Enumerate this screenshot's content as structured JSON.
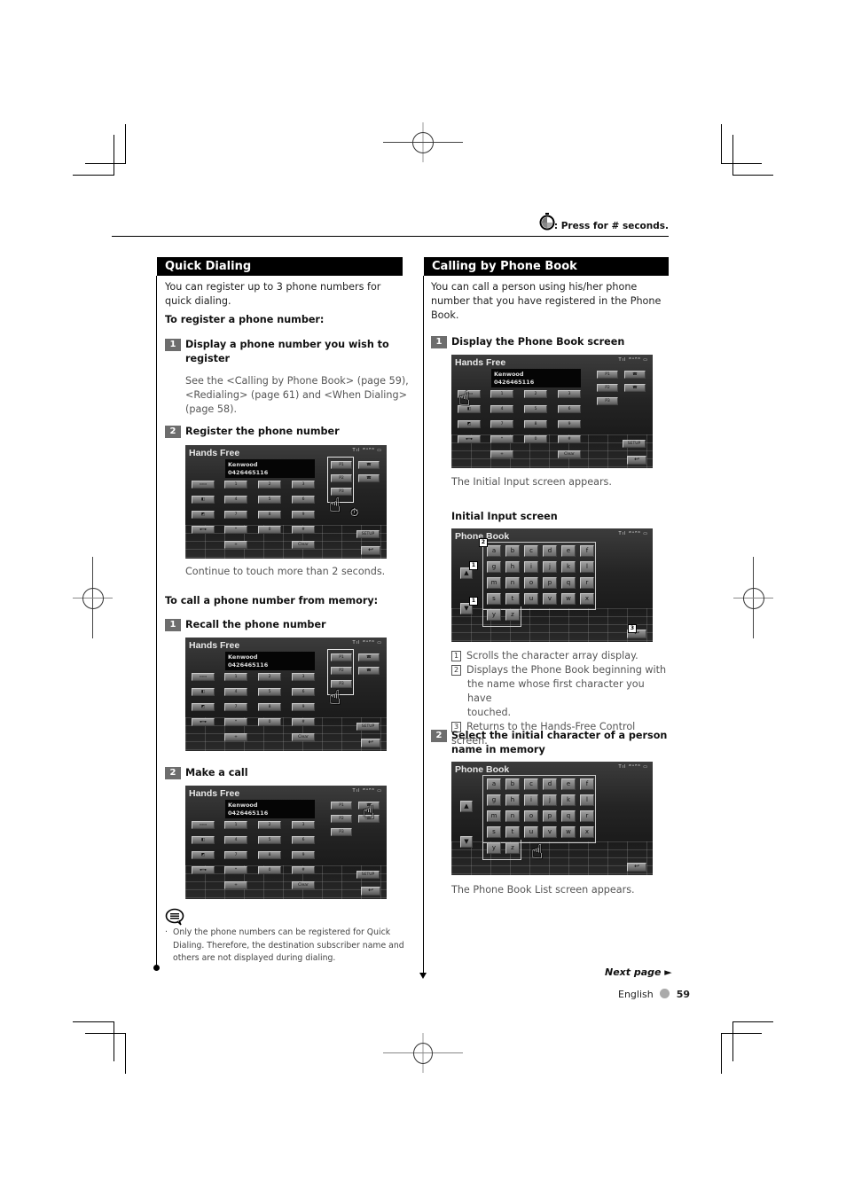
{
  "header": {
    "timer_icon": "stopwatch-icon",
    "press_note": ": Press for # seconds."
  },
  "left": {
    "section_title": "Quick Dialing",
    "intro": "You can register up to 3 phone numbers for quick dialing.",
    "register_heading": "To register a phone number:",
    "register_steps": [
      {
        "num": "1",
        "title_line1": "Display a phone number you wish to",
        "title_line2": "register",
        "body_line1": "See the <Calling by Phone Book> (page 59),",
        "body_line2": "<Redialing> (page 61) and <When Dialing>",
        "body_line3": "(page 58)."
      },
      {
        "num": "2",
        "title": "Register the phone number",
        "caption": "Continue to touch more than 2 seconds."
      }
    ],
    "call_heading": "To call a phone number from memory:",
    "call_steps": [
      {
        "num": "1",
        "title": "Recall the phone number"
      },
      {
        "num": "2",
        "title": "Make a call"
      }
    ],
    "note_icon": "speech-note-icon",
    "note_line1": "Only the phone numbers can be registered for Quick",
    "note_line2": "Dialing. Therefore, the destination subscriber name and",
    "note_line3": "others are not displayed during dialing."
  },
  "right": {
    "section_title": "Calling by Phone Book",
    "intro_line1": "You can call a person using his/her phone",
    "intro_line2": "number that you have registered in the Phone",
    "intro_line3": "Book.",
    "steps": [
      {
        "num": "1",
        "title": "Display the Phone Book screen",
        "caption": "The Initial Input screen appears."
      },
      {
        "num": "2",
        "title_line1": "Select the initial character of a person",
        "title_line2": "name in memory",
        "caption": "The Phone Book List screen appears."
      }
    ],
    "initial_input_heading": "Initial Input screen",
    "legend": [
      {
        "num": "1",
        "text": "Scrolls the character array display."
      },
      {
        "num": "2",
        "text_line1": "Displays the Phone Book beginning with",
        "text_line2": "the name whose first character you have",
        "text_line3": "touched."
      },
      {
        "num": "3",
        "text": "Returns to the Hands-Free Control screen."
      }
    ]
  },
  "hands_free_screen": {
    "title": "Hands Free",
    "status": "Tıl ᵂᴬᴿᴺ ▭",
    "contact_name": "Kenwood",
    "contact_number": "0426465116",
    "keypad": [
      "1",
      "2",
      "3",
      "4",
      "5",
      "6",
      "7",
      "8",
      "9",
      "*",
      "0",
      "#",
      "+",
      "Clear"
    ],
    "presets": [
      "P1",
      "P2",
      "P3"
    ],
    "setup_label": "SETUP"
  },
  "phone_book_screen": {
    "title": "Phone Book",
    "letters": [
      "a",
      "b",
      "c",
      "d",
      "e",
      "f",
      "g",
      "h",
      "i",
      "j",
      "k",
      "l",
      "m",
      "n",
      "o",
      "p",
      "q",
      "r",
      "s",
      "t",
      "u",
      "v",
      "w",
      "x",
      "y",
      "z"
    ],
    "up_arrow": "▲",
    "down_arrow": "▼"
  },
  "footer": {
    "next_page": "Next page ►",
    "language": "English",
    "page_number": "59"
  }
}
